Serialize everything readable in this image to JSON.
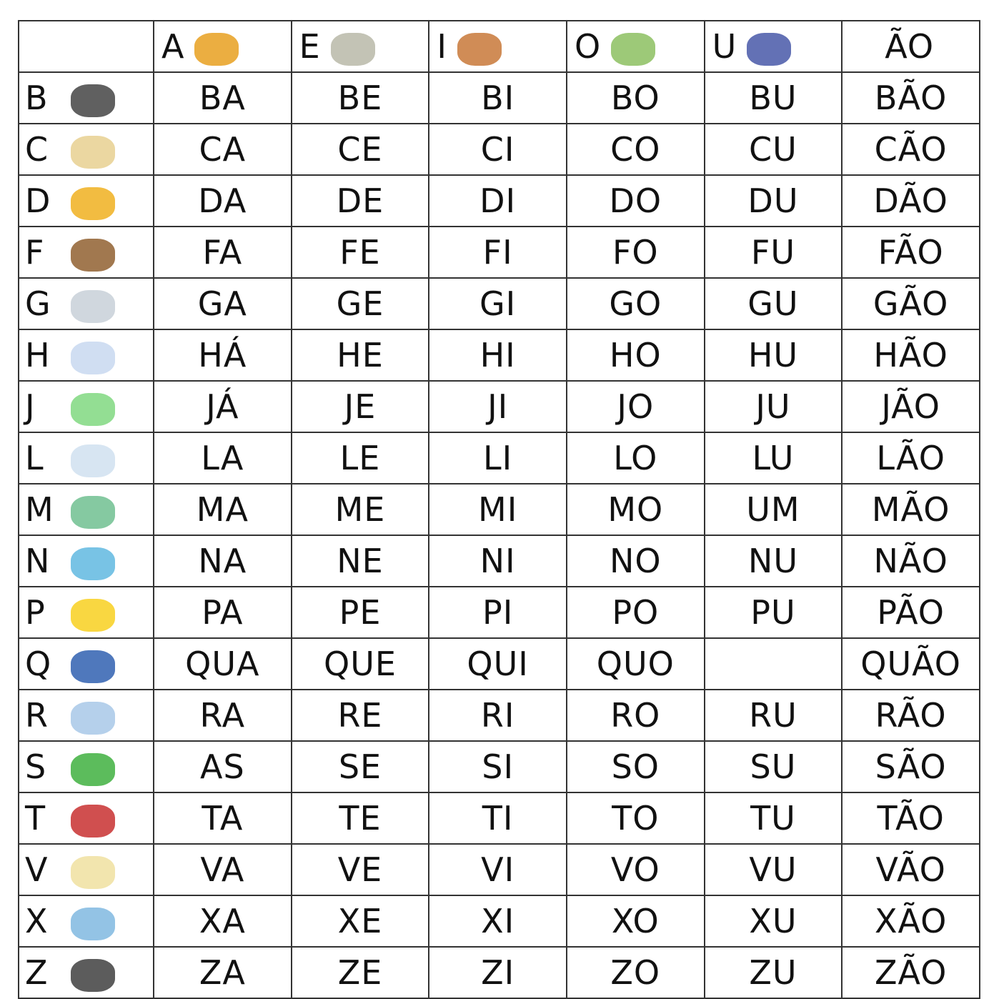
{
  "header": {
    "columns": [
      {
        "letter": "A",
        "icon": "airplane-icon",
        "color": "#e8a020"
      },
      {
        "letter": "E",
        "icon": "elephant-icon",
        "color": "#b8b8a8"
      },
      {
        "letter": "I",
        "icon": "house-icon",
        "color": "#c87838"
      },
      {
        "letter": "O",
        "icon": "eye-icon",
        "color": "#8cc060"
      },
      {
        "letter": "U",
        "icon": "grapes-icon",
        "color": "#4858a8"
      },
      {
        "letter": "ÃO",
        "icon": "",
        "color": ""
      }
    ]
  },
  "rows": [
    {
      "letter": "B",
      "icon": "ball-icon",
      "color": "#444444",
      "syllables": [
        "BA",
        "BE",
        "BI",
        "BO",
        "BU",
        "BÃO"
      ]
    },
    {
      "letter": "C",
      "icon": "dog-icon",
      "color": "#e8d090",
      "syllables": [
        "CA",
        "CE",
        "CI",
        "CO",
        "CU",
        "CÃO"
      ]
    },
    {
      "letter": "D",
      "icon": "cheese-icon",
      "color": "#f0b020",
      "syllables": [
        "DA",
        "DE",
        "DI",
        "DO",
        "DU",
        "DÃO"
      ]
    },
    {
      "letter": "F",
      "icon": "knife-icon",
      "color": "#906030",
      "syllables": [
        "FA",
        "FE",
        "FI",
        "FO",
        "FU",
        "FÃO"
      ]
    },
    {
      "letter": "G",
      "icon": "cat-icon",
      "color": "#c8d0d8",
      "syllables": [
        "GA",
        "GE",
        "GI",
        "GO",
        "GU",
        "GÃO"
      ]
    },
    {
      "letter": "H",
      "icon": "hippo-icon",
      "color": "#c8d8f0",
      "syllables": [
        "HÁ",
        "HE",
        "HI",
        "HO",
        "HU",
        "HÃO"
      ]
    },
    {
      "letter": "J",
      "icon": "alligator-icon",
      "color": "#80d880",
      "syllables": [
        "JÁ",
        "JE",
        "JI",
        "JO",
        "JU",
        "JÃO"
      ]
    },
    {
      "letter": "L",
      "icon": "bottle-icon",
      "color": "#d0e0f0",
      "syllables": [
        "LA",
        "LE",
        "LI",
        "LO",
        "LU",
        "LÃO"
      ]
    },
    {
      "letter": "M",
      "icon": "suitcase-icon",
      "color": "#70c090",
      "syllables": [
        "MA",
        "ME",
        "MI",
        "MO",
        "UM",
        "MÃO"
      ]
    },
    {
      "letter": "N",
      "icon": "ship-icon",
      "color": "#60b8e0",
      "syllables": [
        "NA",
        "NE",
        "NI",
        "NO",
        "NU",
        "NÃO"
      ]
    },
    {
      "letter": "P",
      "icon": "duck-icon",
      "color": "#f8d020",
      "syllables": [
        "PA",
        "PE",
        "PI",
        "PO",
        "PU",
        "PÃO"
      ]
    },
    {
      "letter": "Q",
      "icon": "bell-icon",
      "color": "#3060b0",
      "syllables": [
        "QUA",
        "QUE",
        "QUI",
        "QUO",
        "",
        "QUÃO"
      ]
    },
    {
      "letter": "R",
      "icon": "rat-icon",
      "color": "#a8c8e8",
      "syllables": [
        "RA",
        "RE",
        "RI",
        "RO",
        "RU",
        "RÃO"
      ]
    },
    {
      "letter": "S",
      "icon": "frog-icon",
      "color": "#40b040",
      "syllables": [
        "AS",
        "SE",
        "SI",
        "SO",
        "SU",
        "SÃO"
      ]
    },
    {
      "letter": "T",
      "icon": "tank-icon",
      "color": "#c83030",
      "syllables": [
        "TA",
        "TE",
        "TI",
        "TO",
        "TU",
        "TÃO"
      ]
    },
    {
      "letter": "V",
      "icon": "cow-icon",
      "color": "#f0e0a0",
      "syllables": [
        "VA",
        "VE",
        "VI",
        "VO",
        "VU",
        "VÃO"
      ]
    },
    {
      "letter": "X",
      "icon": "cup-icon",
      "color": "#80b8e0",
      "syllables": [
        "XA",
        "XE",
        "XI",
        "XO",
        "XU",
        "XÃO"
      ]
    },
    {
      "letter": "Z",
      "icon": "zebra-icon",
      "color": "#404040",
      "syllables": [
        "ZA",
        "ZE",
        "ZI",
        "ZO",
        "ZU",
        "ZÃO"
      ]
    }
  ]
}
